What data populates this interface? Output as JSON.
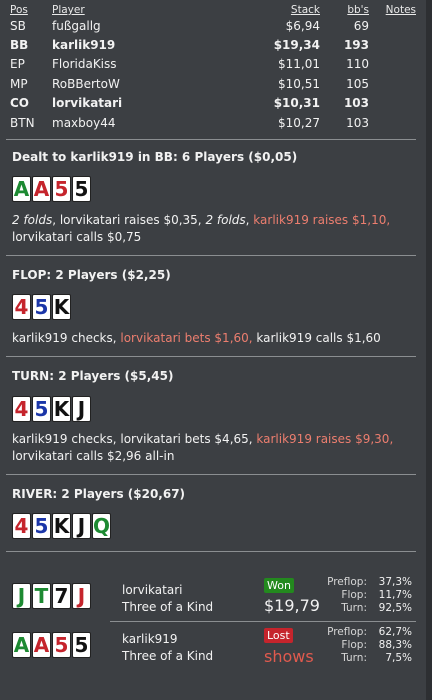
{
  "colors": {
    "background": "#3c3f43",
    "hero_action": "#ec7e6f",
    "won_badge": "#23891e",
    "lost_badge": "#c5242c"
  },
  "header": {
    "pos": "Pos",
    "player": "Player",
    "stack": "Stack",
    "bbs": "bb's",
    "notes": "Notes"
  },
  "players": [
    {
      "pos": "SB",
      "player": "fußgallg",
      "stack": "$6,94",
      "bbs": "69",
      "bold": false
    },
    {
      "pos": "BB",
      "player": "karlik919",
      "stack": "$19,34",
      "bbs": "193",
      "bold": true
    },
    {
      "pos": "EP",
      "player": "FloridaKiss",
      "stack": "$11,01",
      "bbs": "110",
      "bold": false
    },
    {
      "pos": "MP",
      "player": "RoBBertoW",
      "stack": "$10,51",
      "bbs": "105",
      "bold": false
    },
    {
      "pos": "CO",
      "player": "lorvikatari",
      "stack": "$10,31",
      "bbs": "103",
      "bold": true
    },
    {
      "pos": "BTN",
      "player": "maxboy44",
      "stack": "$10,27",
      "bbs": "103",
      "bold": false
    }
  ],
  "preflop": {
    "title": "Dealt to karlik919 in BB: 6 Players ($0,05)",
    "cards": [
      {
        "rank": "A",
        "suit": "g"
      },
      {
        "rank": "A",
        "suit": "r"
      },
      {
        "rank": "5",
        "suit": "r"
      },
      {
        "rank": "5",
        "suit": "k"
      }
    ],
    "action": {
      "fold1": "2 folds",
      "p1": ", lorvikatari raises $0,35, ",
      "fold2": "2 folds",
      "p2": ", ",
      "hero1": "karlik919 raises $1,10,",
      "p3": " lorvikatari calls $0,75"
    }
  },
  "flop": {
    "title": "FLOP: 2 Players ($2,25)",
    "cards": [
      {
        "rank": "4",
        "suit": "r"
      },
      {
        "rank": "5",
        "suit": "b"
      },
      {
        "rank": "K",
        "suit": "k"
      }
    ],
    "action": {
      "p1": "karlik919 checks, ",
      "hero1": "lorvikatari bets $1,60,",
      "p2": " karlik919 calls $1,60"
    }
  },
  "turn": {
    "title": "TURN: 2 Players ($5,45)",
    "cards": [
      {
        "rank": "4",
        "suit": "r"
      },
      {
        "rank": "5",
        "suit": "b"
      },
      {
        "rank": "K",
        "suit": "k"
      },
      {
        "rank": "J",
        "suit": "k"
      }
    ],
    "action": {
      "p1": "karlik919 checks, lorvikatari bets $4,65, ",
      "hero1": "karlik919 raises $9,30,",
      "p2": " lorvikatari calls $2,96 all-in"
    }
  },
  "river": {
    "title": "RIVER: 2 Players ($20,67)",
    "cards": [
      {
        "rank": "4",
        "suit": "r"
      },
      {
        "rank": "5",
        "suit": "b"
      },
      {
        "rank": "K",
        "suit": "k"
      },
      {
        "rank": "J",
        "suit": "k"
      },
      {
        "rank": "Q",
        "suit": "g"
      }
    ]
  },
  "results": [
    {
      "cards": [
        {
          "rank": "J",
          "suit": "g"
        },
        {
          "rank": "T",
          "suit": "g"
        },
        {
          "rank": "7",
          "suit": "k"
        },
        {
          "rank": "J",
          "suit": "r"
        }
      ],
      "name": "lorvikatari",
      "hand": "Three of a Kind",
      "badge": "Won",
      "amount": "$19,79",
      "stats": {
        "preflop_label": "Preflop:",
        "preflop": "37,3%",
        "flop_label": "Flop:",
        "flop": "11,7%",
        "turn_label": "Turn:",
        "turn": "92,5%"
      }
    },
    {
      "cards": [
        {
          "rank": "A",
          "suit": "g"
        },
        {
          "rank": "A",
          "suit": "r"
        },
        {
          "rank": "5",
          "suit": "r"
        },
        {
          "rank": "5",
          "suit": "k"
        }
      ],
      "name": "karlik919",
      "hand": "Three of a Kind",
      "badge": "Lost",
      "amount": "shows",
      "stats": {
        "preflop_label": "Preflop:",
        "preflop": "62,7%",
        "flop_label": "Flop:",
        "flop": "88,3%",
        "turn_label": "Turn:",
        "turn": "7,5%"
      }
    }
  ]
}
